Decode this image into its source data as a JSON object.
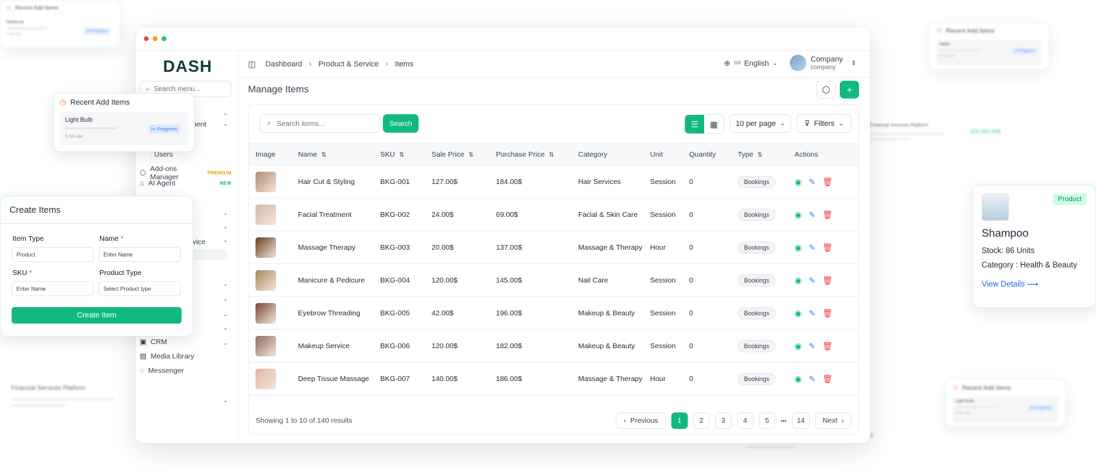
{
  "sidebar": {
    "logo": "DASH",
    "search_placeholder": "Search menu...",
    "items": [
      {
        "label": "Users"
      },
      {
        "label": "Add-ons Manager",
        "tag": "PREMIUM"
      },
      {
        "label": "AI Agent",
        "tag": "NEW"
      },
      {
        "label": "CRM"
      },
      {
        "label": "Media Library"
      },
      {
        "label": "Messenger"
      }
    ],
    "partial_labels": [
      "ement",
      "ervice"
    ]
  },
  "topbar": {
    "breadcrumbs": [
      "Dashboard",
      "Product & Service",
      "Items"
    ],
    "lang_code": "GB",
    "language": "English",
    "company_name": "Company",
    "company_sub": "company"
  },
  "page": {
    "title": "Manage Items"
  },
  "table_controls": {
    "search_placeholder": "Search items...",
    "search_button": "Search",
    "per_page": "10 per page",
    "filters": "Filters"
  },
  "table": {
    "headers": [
      "Image",
      "Name",
      "SKU",
      "Sale Price",
      "Purchase Price",
      "Category",
      "Unit",
      "Quantity",
      "Type",
      "Actions"
    ],
    "rows": [
      {
        "name": "Hair Cut & Styling",
        "sku": "BKG-001",
        "sale": "127.00$",
        "purchase": "184.00$",
        "category": "Hair Services",
        "unit": "Session",
        "qty": "0",
        "type": "Bookings",
        "color": "#b08d72"
      },
      {
        "name": "Facial Treatment",
        "sku": "BKG-002",
        "sale": "24.00$",
        "purchase": "69.00$",
        "category": "Facial & Skin Care",
        "unit": "Session",
        "qty": "0",
        "type": "Bookings",
        "color": "#d4b9a6"
      },
      {
        "name": "Massage Therapy",
        "sku": "BKG-003",
        "sale": "20.00$",
        "purchase": "137.00$",
        "category": "Massage & Therapy",
        "unit": "Hour",
        "qty": "0",
        "type": "Bookings",
        "color": "#6b3f1f"
      },
      {
        "name": "Manicure & Pedicure",
        "sku": "BKG-004",
        "sale": "120.00$",
        "purchase": "145.00$",
        "category": "Nail Care",
        "unit": "Session",
        "qty": "0",
        "type": "Bookings",
        "color": "#a8875f"
      },
      {
        "name": "Eyebrow Threading",
        "sku": "BKG-005",
        "sale": "42.00$",
        "purchase": "196.00$",
        "category": "Makeup & Beauty",
        "unit": "Session",
        "qty": "0",
        "type": "Bookings",
        "color": "#7a4a35"
      },
      {
        "name": "Makeup Service",
        "sku": "BKG-006",
        "sale": "120.00$",
        "purchase": "182.00$",
        "category": "Makeup & Beauty",
        "unit": "Session",
        "qty": "0",
        "type": "Bookings",
        "color": "#8c6e5e"
      },
      {
        "name": "Deep Tissue Massage",
        "sku": "BKG-007",
        "sale": "140.00$",
        "purchase": "186.00$",
        "category": "Massage & Therapy",
        "unit": "Hour",
        "qty": "0",
        "type": "Bookings",
        "color": "#e0b8a3"
      }
    ]
  },
  "footer": {
    "showing": "Showing 1 to 10 of 140 results",
    "prev": "Previous",
    "next": "Next",
    "pages": [
      "1",
      "2",
      "3",
      "4",
      "5",
      "•••",
      "14"
    ]
  },
  "recent_card": {
    "title": "Recent Add Items",
    "item": "Light Bulb",
    "status": "In Progress",
    "time": "5 min ago"
  },
  "recent_card_right": {
    "title": "Recent Add Items",
    "item": "Apple",
    "status": "In Progress",
    "time": "5 min ago"
  },
  "recent_card_br": {
    "title": "Recent Add Items",
    "item": "Light Bulb",
    "status": "In Progress",
    "time": "5 min ago"
  },
  "recent_card_tl": {
    "title": "Recent Add Items",
    "item": "Notebook",
    "status": "In Progress",
    "time": "5 min ago"
  },
  "create_form": {
    "title": "Create Items",
    "item_type_label": "Item Type",
    "item_type_value": "Product",
    "name_label": "Name",
    "name_placeholder": "Enter Name",
    "sku_label": "SKU",
    "sku_placeholder": "Enter Name",
    "product_type_label": "Product Type",
    "product_type_placeholder": "Select Product type",
    "submit": "Create Item"
  },
  "product_card": {
    "badge": "Product",
    "name": "Shampoo",
    "stock": "Stock: 86 Units",
    "category": "Category : Health & Beauty",
    "link": "View Details"
  },
  "blurred": {
    "platform": "Financial Services Platform",
    "amount": "320,000.00$"
  },
  "colors": {
    "accent": "#10b981",
    "delete": "#ef4444",
    "edit": "#3b82f6",
    "premium": "#f59e0b"
  }
}
